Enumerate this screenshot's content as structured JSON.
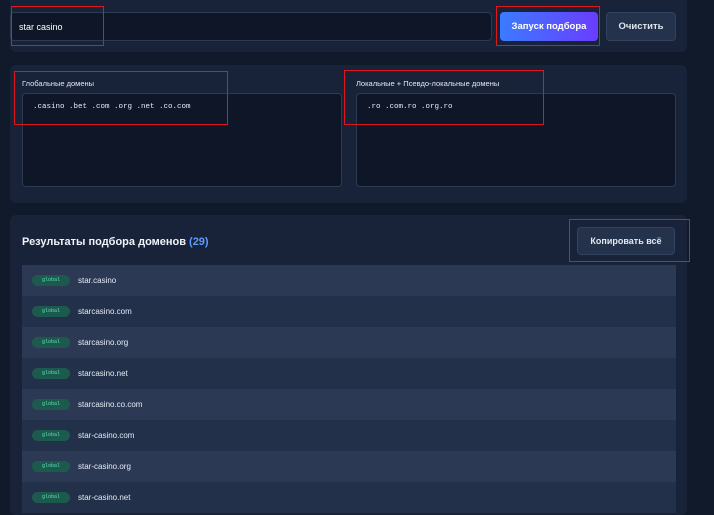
{
  "search": {
    "value": "star casino"
  },
  "buttons": {
    "run": "Запуск подбора",
    "clear": "Очистить",
    "copy_all": "Копировать всё"
  },
  "domains": {
    "global_label": "Глобальные домены",
    "global_value": ".casino .bet .com .org .net .co.com",
    "local_label": "Локальные + Псевдо-локальные домены",
    "local_value": ".ro .com.ro .org.ro"
  },
  "results": {
    "title": "Результаты подбора доменов",
    "count": "(29)",
    "items": [
      {
        "badge": "global",
        "domain": "star.casino"
      },
      {
        "badge": "global",
        "domain": "starcasino.com"
      },
      {
        "badge": "global",
        "domain": "starcasino.org"
      },
      {
        "badge": "global",
        "domain": "starcasino.net"
      },
      {
        "badge": "global",
        "domain": "starcasino.co.com"
      },
      {
        "badge": "global",
        "domain": "star-casino.com"
      },
      {
        "badge": "global",
        "domain": "star-casino.org"
      },
      {
        "badge": "global",
        "domain": "star-casino.net"
      }
    ]
  },
  "colors": {
    "accent_start": "#3b7bff",
    "accent_end": "#6a3dff",
    "count": "#5b9cff",
    "badge_text": "#5fe0b6",
    "highlight": "#e0161d"
  }
}
